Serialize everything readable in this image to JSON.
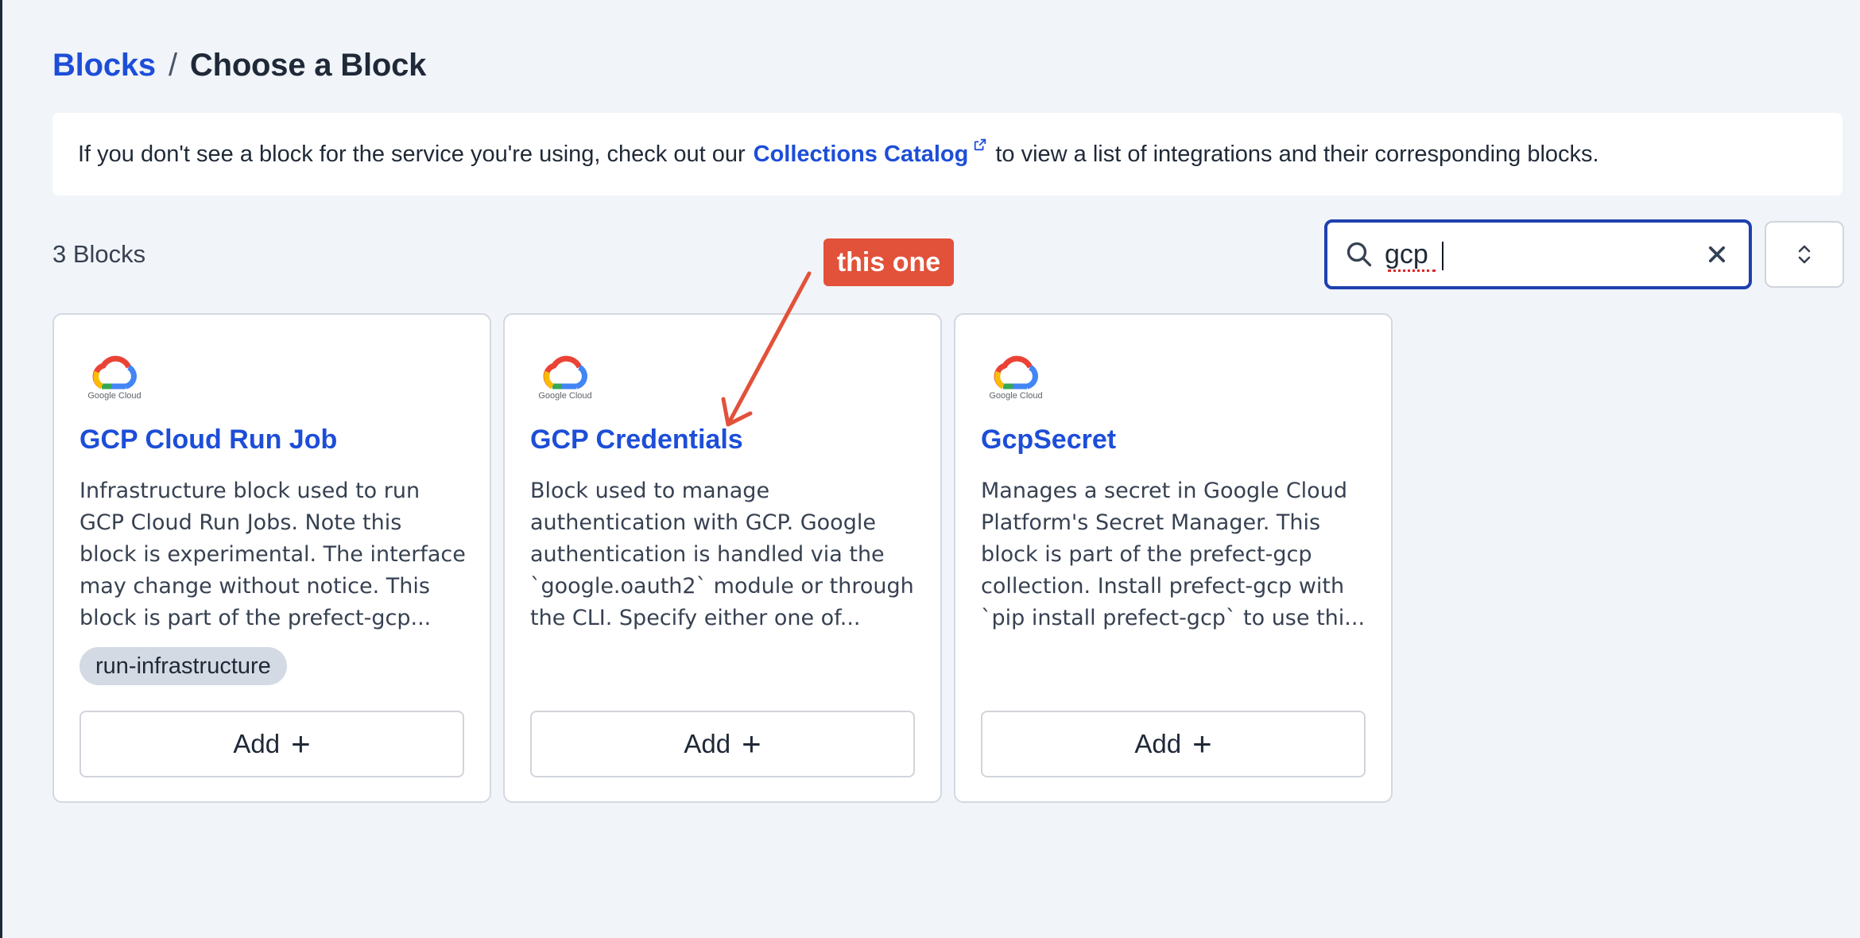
{
  "breadcrumb": {
    "parent": "Blocks",
    "separator": "/",
    "current": "Choose a Block"
  },
  "banner": {
    "text_before": "If you don't see a block for the service you're using, check out our",
    "link_text": "Collections Catalog",
    "text_after": "to view a list of integrations and their corresponding blocks."
  },
  "results": {
    "count_label": "3 Blocks"
  },
  "search": {
    "value": "gcp",
    "icon": "search-icon",
    "clear_icon": "close-icon"
  },
  "sort": {
    "icon": "chevron-up-down-icon"
  },
  "cards": [
    {
      "logo_text": "Google Cloud",
      "title": "GCP Cloud Run Job",
      "description_lines": [
        "Infrastructure block used to run",
        "GCP Cloud Run Jobs. Note this",
        "block is experimental. The interface",
        "may change without notice. This",
        "block is part of the prefect-gcp..."
      ],
      "tag": "run-infrastructure",
      "add_label": "Add"
    },
    {
      "logo_text": "Google Cloud",
      "title": "GCP Credentials",
      "description_lines": [
        "Block used to manage",
        "authentication with GCP. Google",
        "authentication is handled via the",
        "`google.oauth2` module or through",
        "the CLI. Specify either one of..."
      ],
      "add_label": "Add"
    },
    {
      "logo_text": "Google Cloud",
      "title": "GcpSecret",
      "description_lines": [
        "Manages a secret in Google Cloud",
        "Platform's Secret Manager. This",
        "block is part of the prefect-gcp",
        "collection. Install prefect-gcp with",
        "`pip install prefect-gcp` to use thi..."
      ],
      "add_label": "Add"
    }
  ],
  "annotation": {
    "label": "this one",
    "color": "#e2513a"
  },
  "colors": {
    "link": "#1d4ed8",
    "background": "#f1f4f9",
    "search_border": "#1e40af"
  }
}
